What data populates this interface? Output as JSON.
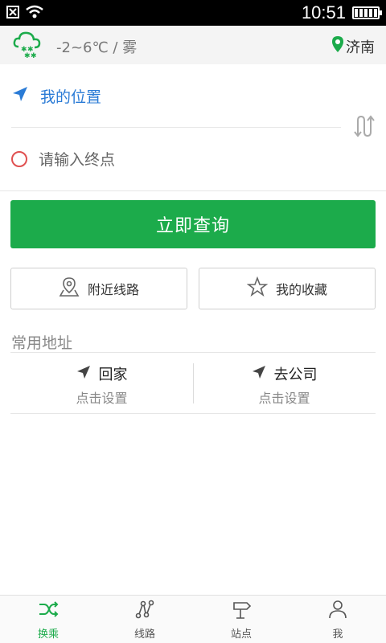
{
  "status_bar": {
    "time": "10:51"
  },
  "weather": {
    "text": "-2~6℃ / 雾",
    "icon": "snow-cloud-icon"
  },
  "city": {
    "name": "济南",
    "icon": "location-pin-icon"
  },
  "route": {
    "start_label": "我的位置",
    "end_placeholder": "请输入终点"
  },
  "search_button": "立即查询",
  "actions": {
    "nearby_label": "附近线路",
    "favorites_label": "我的收藏"
  },
  "common_addresses": {
    "title": "常用地址",
    "home": {
      "label": "回家",
      "sub": "点击设置"
    },
    "work": {
      "label": "去公司",
      "sub": "点击设置"
    }
  },
  "nav": {
    "items": [
      {
        "label": "换乘",
        "icon": "shuffle-icon"
      },
      {
        "label": "线路",
        "icon": "route-icon"
      },
      {
        "label": "站点",
        "icon": "signpost-icon"
      },
      {
        "label": "我",
        "icon": "user-icon"
      }
    ],
    "active_color": "#1cab4b"
  },
  "colors": {
    "accent": "#1cab4b",
    "link_blue": "#2a7bd6",
    "end_marker": "#e05050"
  }
}
